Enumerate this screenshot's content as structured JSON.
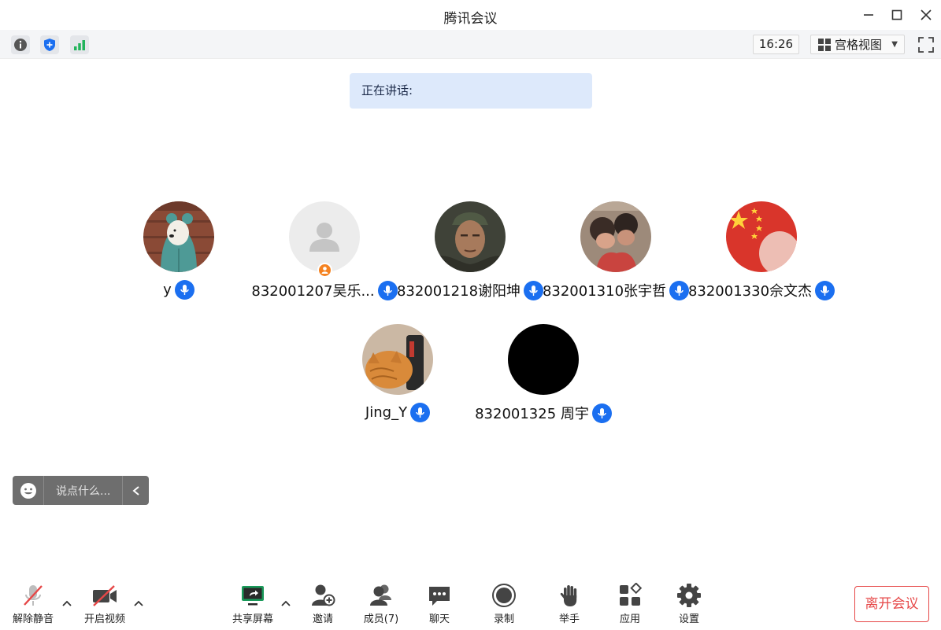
{
  "window": {
    "title": "腾讯会议"
  },
  "toolbar": {
    "time": "16:26",
    "view_mode": "宫格视图"
  },
  "speaking": {
    "label": "正在讲话:"
  },
  "participants": [
    {
      "name": "y",
      "avatar": "bear-hoodie-photo"
    },
    {
      "name": "832001207吴乐...",
      "avatar": "default-user-icon",
      "guest_badge": true
    },
    {
      "name": "832001218谢阳坤",
      "avatar": "man-cap-photo"
    },
    {
      "name": "832001310张宇哲",
      "avatar": "children-photo"
    },
    {
      "name": "832001330佘文杰",
      "avatar": "flag-photo"
    },
    {
      "name": "Jing_Y",
      "avatar": "cat-photo"
    },
    {
      "name": "832001325 周宇",
      "avatar": "black-circle"
    }
  ],
  "chat": {
    "placeholder": "说点什么..."
  },
  "bottombar": {
    "unmute": "解除静音",
    "start_video": "开启视频",
    "share_screen": "共享屏幕",
    "invite": "邀请",
    "members": "成员(7)",
    "chat": "聊天",
    "record": "录制",
    "raise_hand": "举手",
    "apps": "应用",
    "settings": "设置",
    "leave": "离开会议"
  },
  "colors": {
    "accent_blue": "#1b6ff0",
    "leave_red": "#e64747",
    "speaking_bg": "#dde9fb",
    "signal_green": "#21b35b"
  }
}
